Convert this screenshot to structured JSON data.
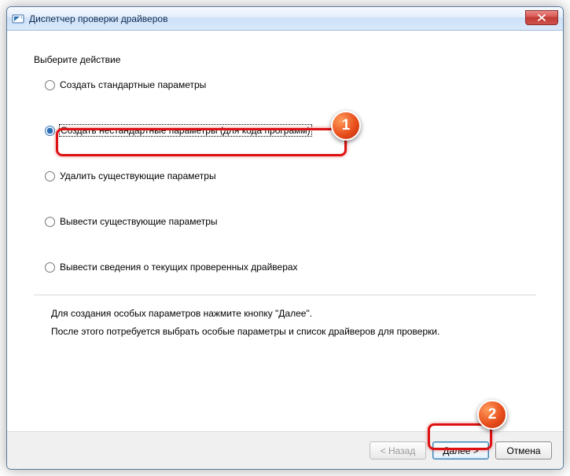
{
  "window": {
    "title": "Диспетчер проверки драйверов"
  },
  "group": {
    "label": "Выберите действие"
  },
  "options": {
    "standard": "Создать стандартные параметры",
    "custom": "Создать нестандартные параметры (для кода программ)",
    "delete": "Удалить существующие параметры",
    "display": "Вывести существующие параметры",
    "info": "Вывести сведения о текущих проверенных драйверах"
  },
  "help": {
    "line1": "Для создания особых параметров нажмите кнопку \"Далее\".",
    "line2": "После этого потребуется выбрать особые параметры и список драйверов для проверки."
  },
  "buttons": {
    "back": "< Назад",
    "next": "Далее >",
    "cancel": "Отмена"
  },
  "annotations": {
    "badge1": "1",
    "badge2": "2"
  }
}
